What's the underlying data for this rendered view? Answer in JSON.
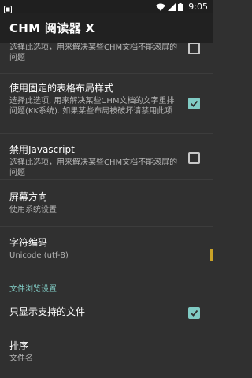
{
  "status_bar": {
    "time": "9:05",
    "icons": [
      "notification-icon",
      "wifi-icon",
      "signal-icon",
      "battery-icon"
    ]
  },
  "app_bar": {
    "title": "CHM 阅读器 X"
  },
  "settings": {
    "item1": {
      "summary": "选择此选项，用来解决某些CHM文档不能滚屏的问题",
      "checked": false
    },
    "item2": {
      "title": "使用固定的表格布局样式",
      "summary": "选择此选项, 用来解决某些CHM文档的文字重排问题(KK系统). 如果某些布局被破坏请禁用此项",
      "checked": true
    },
    "item3": {
      "title": "禁用Javascript",
      "summary": "选择此选项，用来解决某些CHM文档不能滚屏的问题",
      "checked": false
    },
    "item4": {
      "title": "屏幕方向",
      "summary": "使用系统设置"
    },
    "item5": {
      "title": "字符编码",
      "summary": "Unicode (utf-8)"
    },
    "category": "文件浏览设置",
    "item6": {
      "title": "只显示支持的文件",
      "checked": true
    },
    "item7": {
      "title": "排序",
      "summary": "文件名"
    }
  },
  "colors": {
    "accent": "#80cbc4",
    "background": "#303030",
    "appbar": "#212121"
  }
}
